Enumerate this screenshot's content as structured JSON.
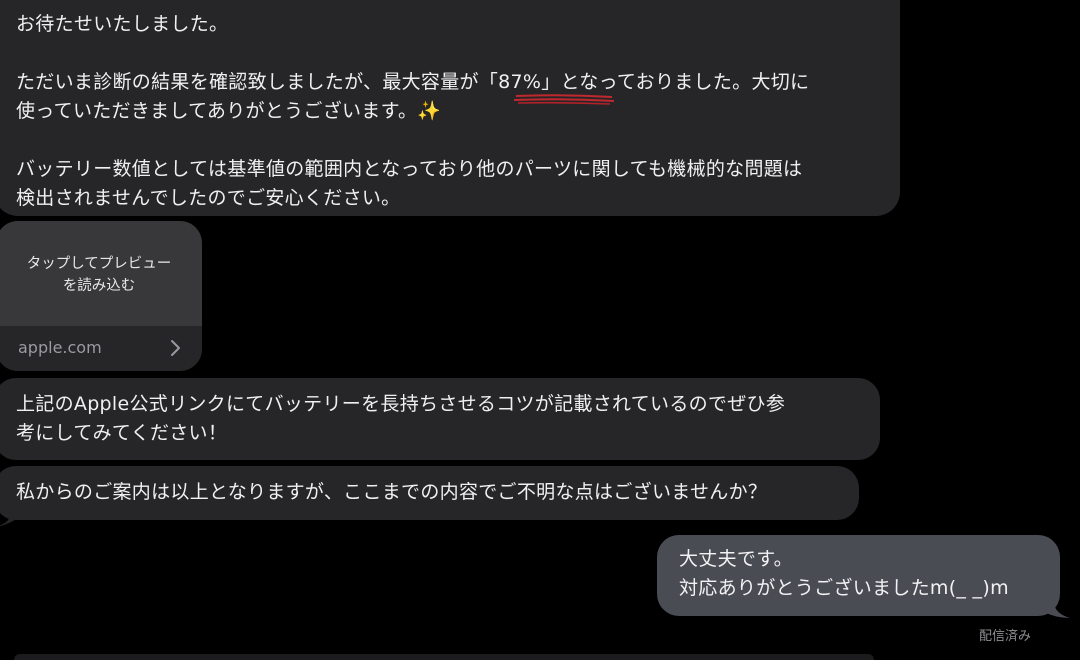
{
  "messages": {
    "m1": {
      "line1": "お待たせいたしました。",
      "line2": "ただいま診断の結果を確認致しましたが、最大容量が「87%」となっておりました。大切に",
      "line3": "使っていただきましてありがとうございます。✨",
      "line4": "バッテリー数値としては基準値の範囲内となっており他のパーツに関しても機械的な問題は",
      "line5": "検出されませんでしたのでご安心ください。"
    },
    "preview": {
      "line1": "タップしてプレビュー",
      "line2": "を読み込む",
      "domain": "apple.com"
    },
    "m2": {
      "line1": "上記のApple公式リンクにてバッテリーを長持ちさせるコツが記載されているのでぜひ参",
      "line2": "考にしてみてください！"
    },
    "m3": {
      "line1": "私からのご案内は以上となりますが、ここまでの内容でご不明な点はございませんか？"
    },
    "reply": {
      "line1": "大丈夫です。",
      "line2": "対応ありがとうございましたm(_ _)m"
    },
    "status": "配信済み"
  },
  "colors": {
    "background": "#000000",
    "incoming_bubble": "#262629",
    "outgoing_bubble": "#4a4c54",
    "highlight_mark": "#c0282d"
  }
}
